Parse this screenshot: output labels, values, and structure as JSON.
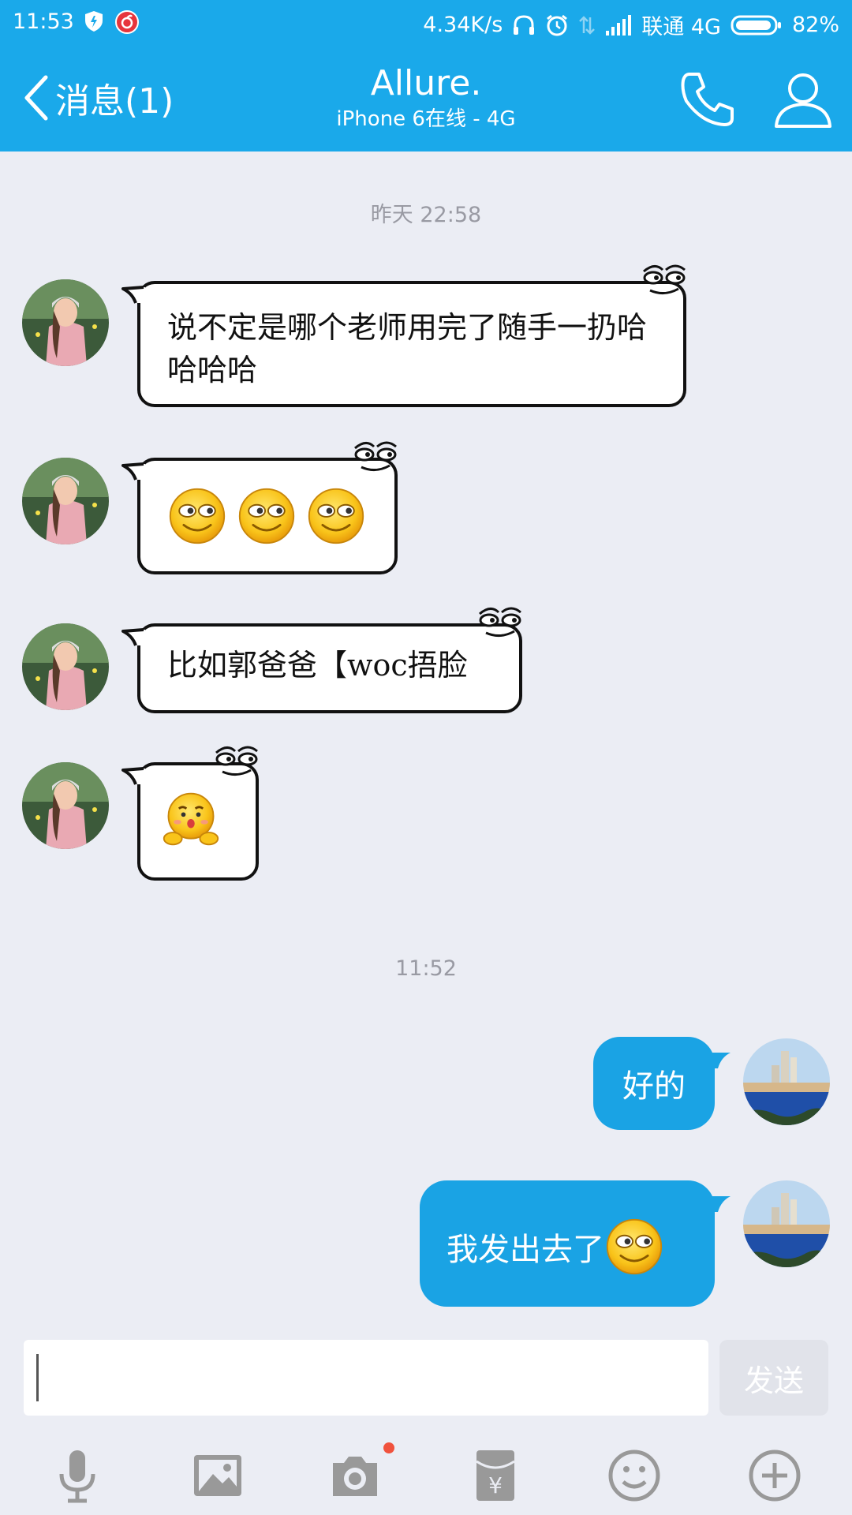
{
  "status_bar": {
    "time": "11:53",
    "net_speed": "4.34K/s",
    "carrier": "联通 4G",
    "battery": "82%"
  },
  "header": {
    "back_label": "消息(1)",
    "title": "Allure.",
    "subtitle": "iPhone 6在线 - 4G"
  },
  "chat": {
    "timestamp_1": "昨天 22:58",
    "msg_1": "说不定是哪个老师用完了随手一扔哈哈哈哈",
    "msg_3": "比如郭爸爸【woc捂脸",
    "timestamp_2": "11:52",
    "msg_out_1": "好的",
    "msg_out_2": "我发出去了"
  },
  "composer": {
    "send_label": "发送"
  },
  "colors": {
    "accent": "#1aa9ea",
    "bubble_out": "#1aa3e4",
    "background": "#ebedf4"
  }
}
